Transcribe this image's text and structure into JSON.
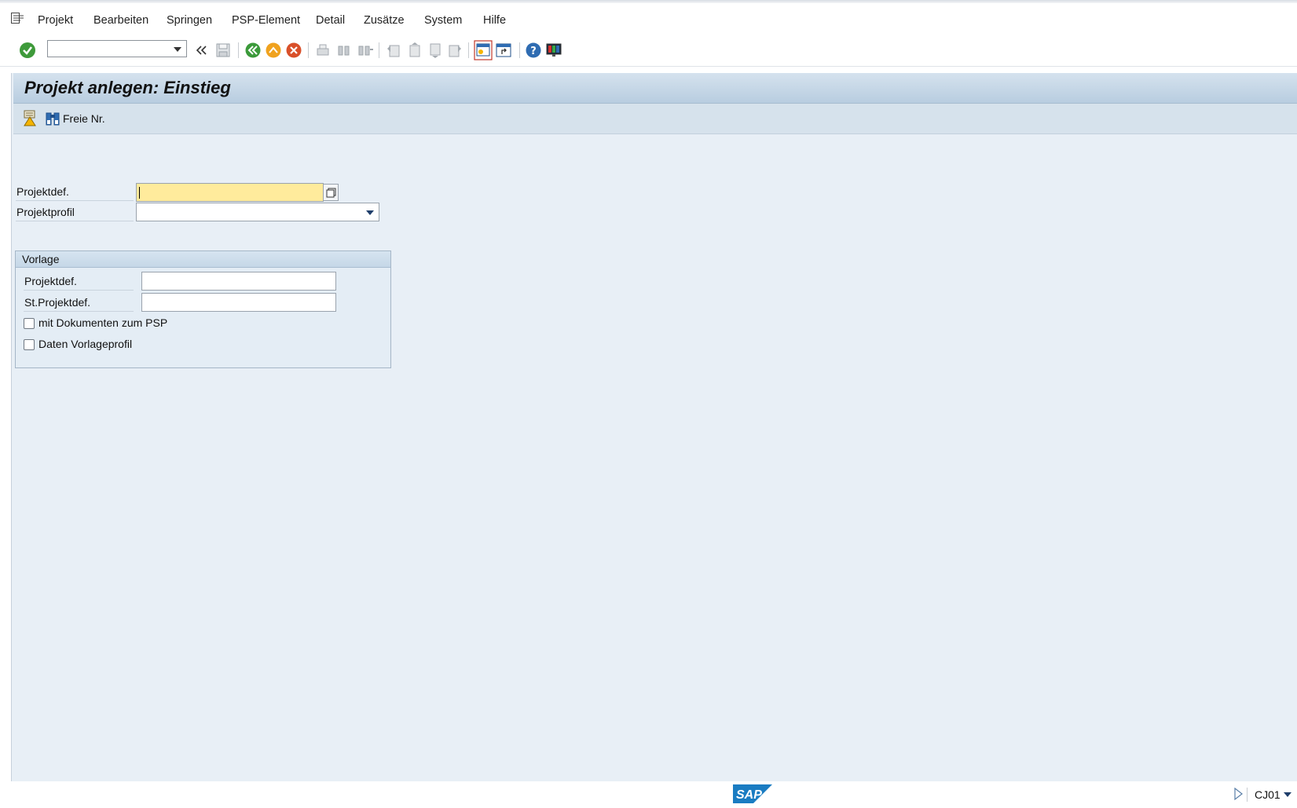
{
  "menu": {
    "items": [
      "Projekt",
      "Bearbeiten",
      "Springen",
      "PSP-Element",
      "Detail",
      "Zusätze",
      "System",
      "Hilfe"
    ]
  },
  "toolbar": {
    "command_field_value": ""
  },
  "screen": {
    "title": "Projekt anlegen: Einstieg",
    "free_number_label": "Freie Nr."
  },
  "form": {
    "projektdef_label": "Projektdef.",
    "projektdef_value": "",
    "projektprofil_label": "Projektprofil",
    "projektprofil_value": ""
  },
  "vorlage": {
    "title": "Vorlage",
    "projektdef_label": "Projektdef.",
    "projektdef_value": "",
    "st_projektdef_label": "St.Projektdef.",
    "st_projektdef_value": "",
    "mit_dokumenten_label": "mit Dokumenten zum PSP",
    "mit_dokumenten_checked": false,
    "daten_vorlageprofil_label": "Daten Vorlageprofil",
    "daten_vorlageprofil_checked": false
  },
  "status": {
    "logo_text": "SAP",
    "transaction_code": "CJ01"
  },
  "colors": {
    "required_field": "#ffeb9c",
    "frame_bg": "#e8eff6",
    "title_bg": "#c5d7e8"
  }
}
